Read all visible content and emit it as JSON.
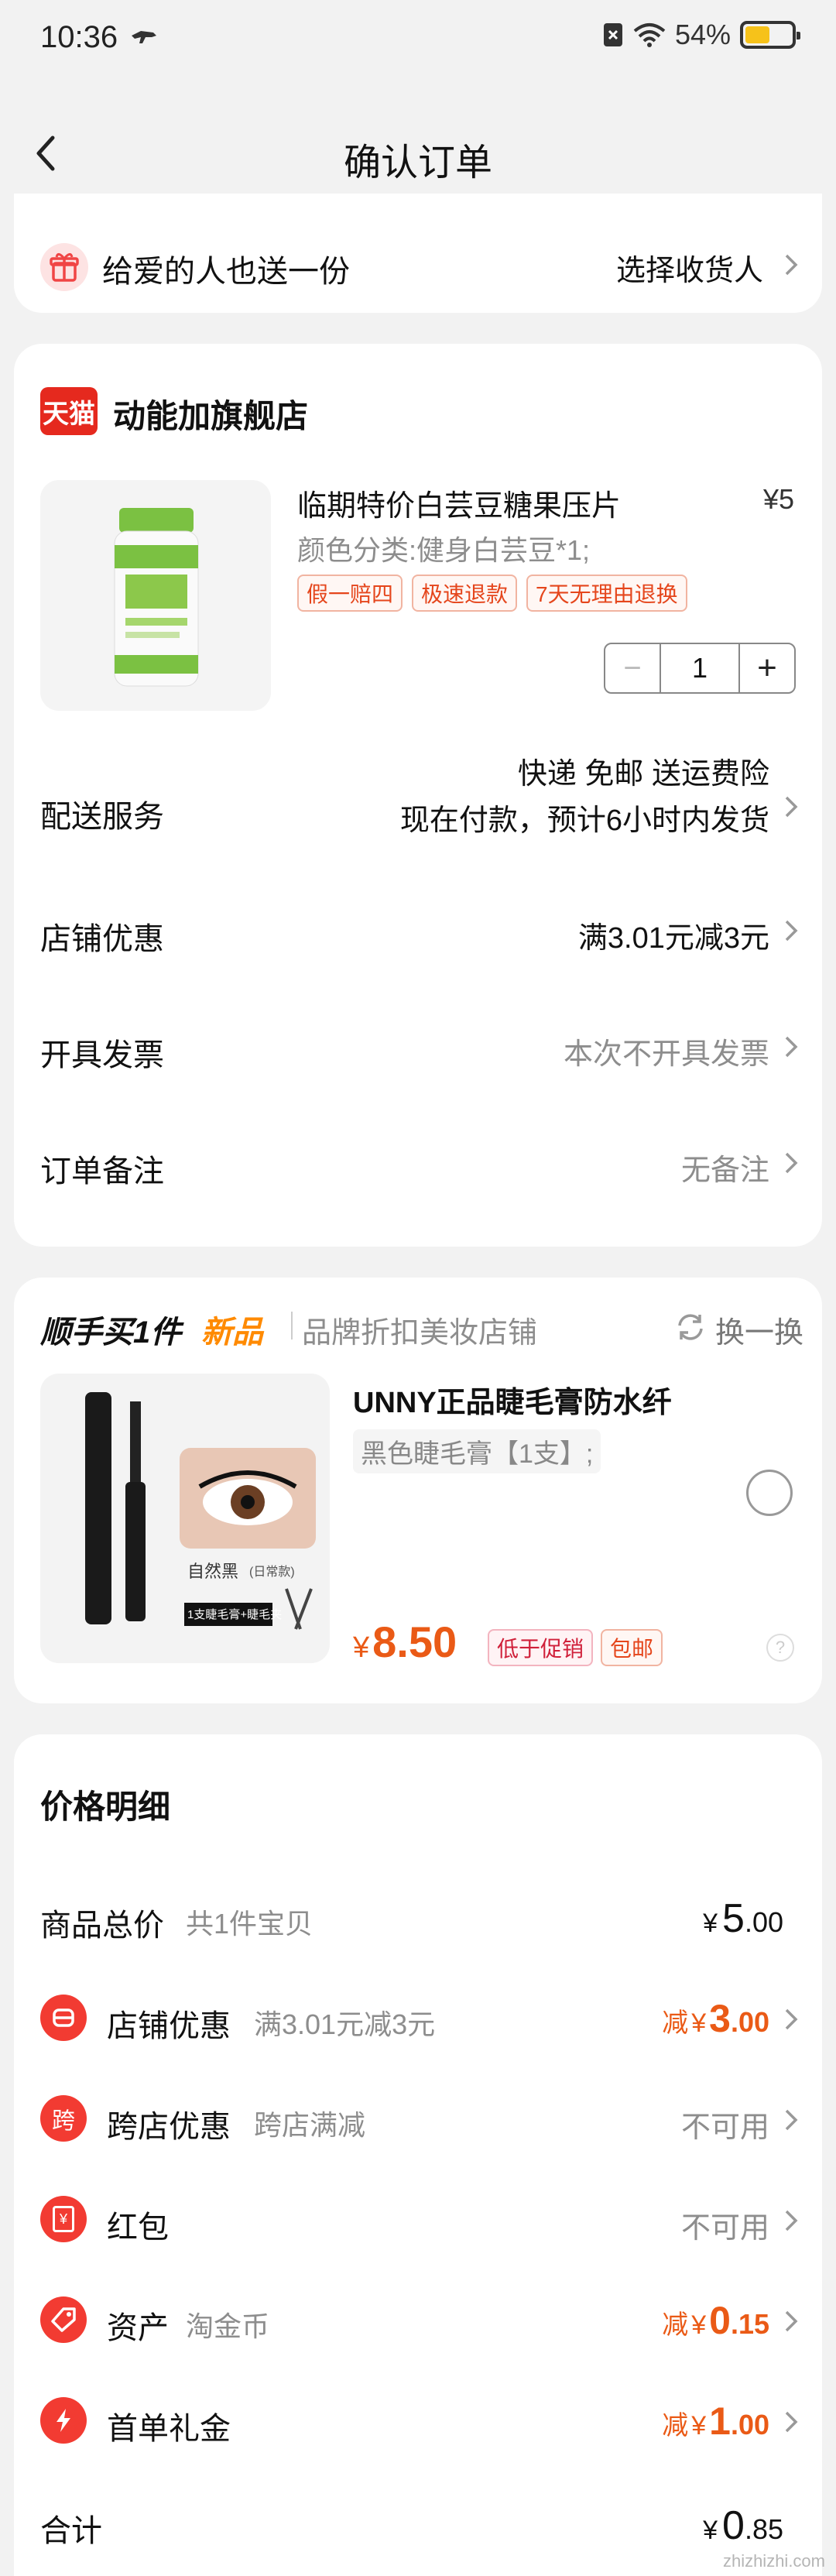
{
  "status_bar": {
    "time": "10:36",
    "battery": "54%",
    "battery_level": 0.54
  },
  "nav": {
    "title": "确认订单"
  },
  "gift": {
    "label": "给爱的人也送一份",
    "action": "选择收货人"
  },
  "store": {
    "badge": "天猫",
    "name": "动能加旗舰店",
    "product": {
      "title": "临期特价白芸豆糖果压片",
      "price": "¥5",
      "variant": "颜色分类:健身白芸豆*1;",
      "tags": [
        "假一赔四",
        "极速退款",
        "7天无理由退换"
      ],
      "qty": "1",
      "minus": "−",
      "plus": "+"
    },
    "rows": [
      {
        "title": "配送服务",
        "value1": "快递 免邮 送运费险",
        "value2": "现在付款，预计6小时内发货"
      },
      {
        "title": "店铺优惠",
        "value": "满3.01元减3元"
      },
      {
        "title": "开具发票",
        "value": "本次不开具发票"
      },
      {
        "title": "订单备注",
        "value": "无备注"
      }
    ]
  },
  "addon": {
    "prefix": "顺手买1件",
    "new": "新品",
    "store": "品牌折扣美妆店铺",
    "swap": "换一换",
    "product": {
      "title": "UNNY正品睫毛膏防水纤",
      "variant": "黑色睫毛膏【1支】;",
      "price_symbol": "¥",
      "price": "8.50",
      "tags": [
        "低于促销",
        "包邮"
      ],
      "img_text1": "自然黑",
      "img_text2": "(日常款)",
      "img_text3": "1支睫毛膏+睫毛夹"
    }
  },
  "price_detail": {
    "title": "价格明细",
    "rows": [
      {
        "label": "商品总价",
        "sub": "共1件宝贝",
        "value_symbol": "¥",
        "value_int": "5",
        "value_dec": ".00",
        "icon": ""
      },
      {
        "label": "店铺优惠",
        "sub": "满3.01元减3元",
        "prefix": "减",
        "value_symbol": "¥",
        "value_int": "3",
        "value_dec": ".00",
        "icon": "store-discount-icon"
      },
      {
        "label": "跨店优惠",
        "sub": "跨店满减",
        "value": "不可用",
        "icon": "cross-store-icon",
        "icon_glyph": "跨"
      },
      {
        "label": "红包",
        "sub": "",
        "value": "不可用",
        "icon": "red-packet-icon",
        "icon_glyph": "¥"
      },
      {
        "label": "资产",
        "sub": "淘金币",
        "prefix": "减",
        "value_symbol": "¥",
        "value_int": "0",
        "value_dec": ".15",
        "icon": "asset-tag-icon"
      },
      {
        "label": "首单礼金",
        "sub": "",
        "prefix": "减",
        "value_symbol": "¥",
        "value_int": "1",
        "value_dec": ".00",
        "icon": "lightning-icon"
      }
    ],
    "total_label": "合计",
    "total_symbol": "¥",
    "total_int": "0",
    "total_dec": ".85"
  },
  "watermark": "zhizhizhi.com",
  "colors": {
    "accent": "#ea5a16",
    "red": "#f23b32",
    "tmall": "#e5291e"
  }
}
